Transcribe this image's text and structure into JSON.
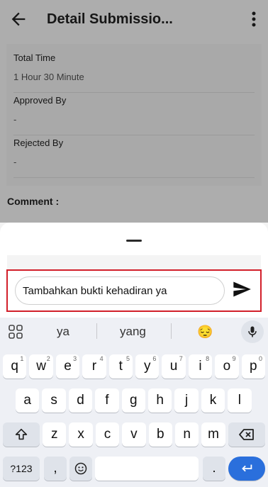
{
  "header": {
    "title": "Detail Submissio...",
    "back_icon": "arrow-left-icon",
    "menu_icon": "more-vert-icon"
  },
  "details": [
    {
      "label": "Total Time",
      "value": "1 Hour 30 Minute"
    },
    {
      "label": "Approved By",
      "value": "-"
    },
    {
      "label": "Rejected By",
      "value": "-"
    }
  ],
  "comment_section": {
    "title": "Comment :"
  },
  "comment_input": {
    "value": "Tambahkan bukti kehadiran ya",
    "send_icon": "send-icon"
  },
  "keyboard": {
    "suggestions": [
      "ya",
      "yang"
    ],
    "emoji_suggestion": "😔",
    "row1": [
      {
        "k": "q",
        "h": "1"
      },
      {
        "k": "w",
        "h": "2"
      },
      {
        "k": "e",
        "h": "3"
      },
      {
        "k": "r",
        "h": "4"
      },
      {
        "k": "t",
        "h": "5"
      },
      {
        "k": "y",
        "h": "6"
      },
      {
        "k": "u",
        "h": "7"
      },
      {
        "k": "i",
        "h": "8"
      },
      {
        "k": "o",
        "h": "9"
      },
      {
        "k": "p",
        "h": "0"
      }
    ],
    "row2": [
      "a",
      "s",
      "d",
      "f",
      "g",
      "h",
      "j",
      "k",
      "l"
    ],
    "row3": [
      "z",
      "x",
      "c",
      "v",
      "b",
      "n",
      "m"
    ],
    "symbols_label": "?123",
    "comma": ",",
    "period": ".",
    "colors": {
      "accent": "#2a6fdc",
      "highlight_border": "#d21f2a"
    }
  }
}
